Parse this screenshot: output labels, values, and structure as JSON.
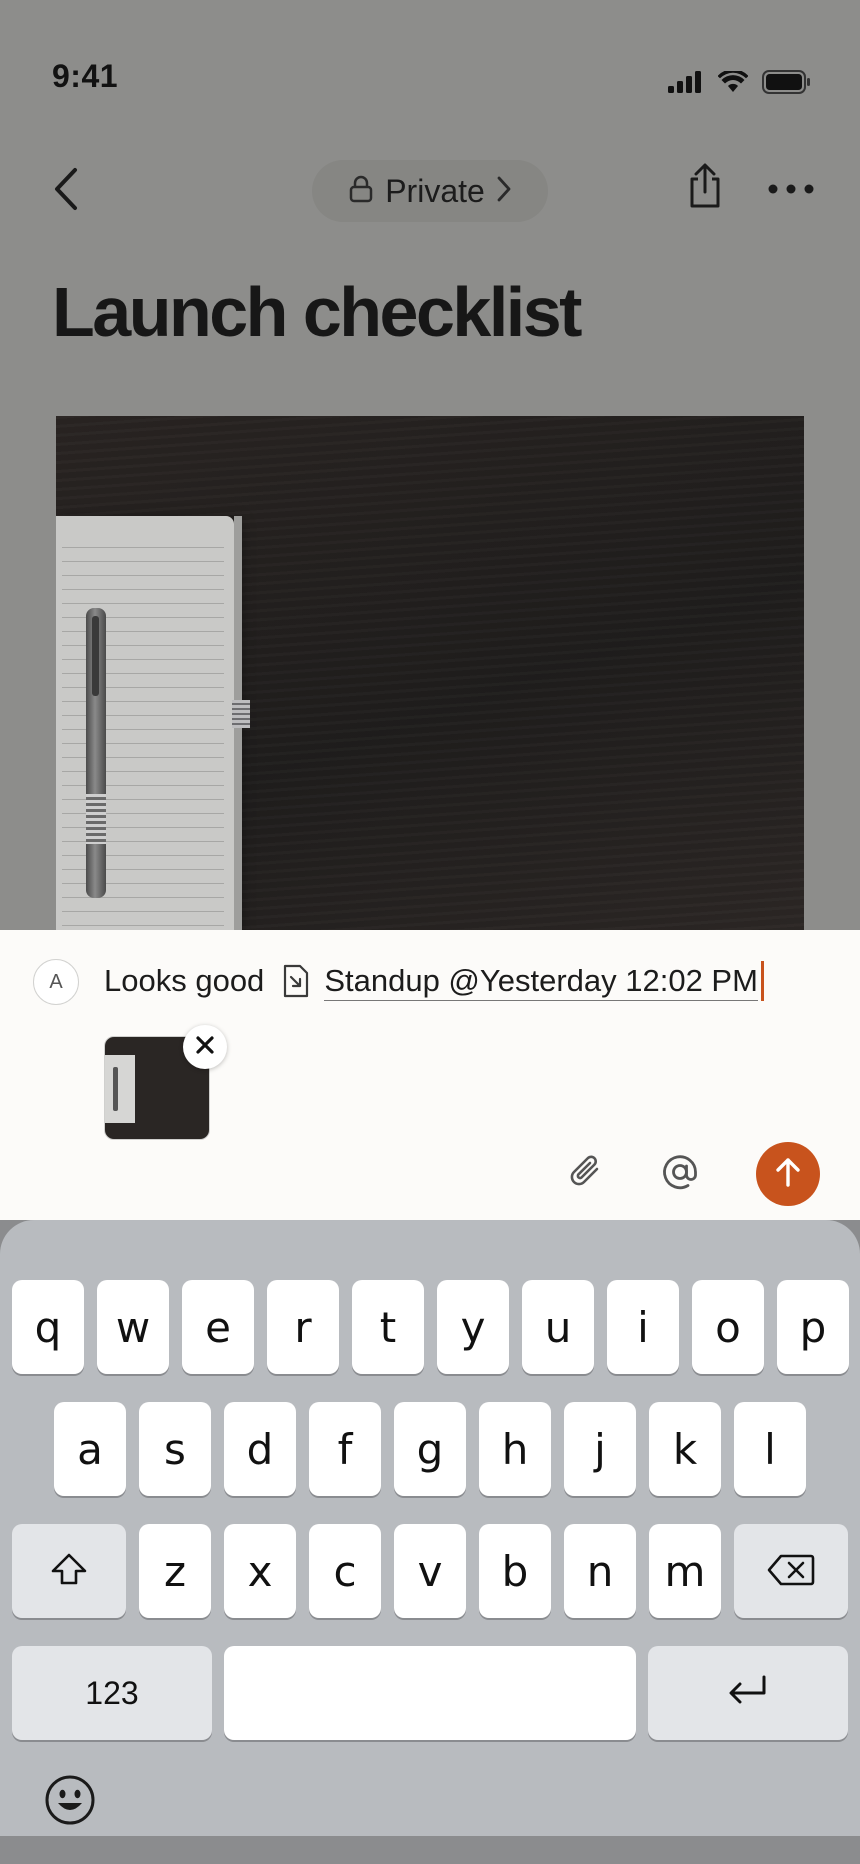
{
  "status_bar": {
    "time": "9:41"
  },
  "nav": {
    "back_icon": "chevron-left-icon",
    "privacy_label": "Private",
    "share_icon": "share-icon",
    "more_icon": "more-horizontal-icon"
  },
  "page": {
    "title": "Launch checklist"
  },
  "composer": {
    "avatar_initial": "A",
    "message_text": "Looks good",
    "mention_text": "Standup @Yesterday 12:02 PM",
    "attachment_icon": "paperclip-icon",
    "mention_icon": "at-sign-icon",
    "send_icon": "arrow-up-icon",
    "accent_color": "#c8531d"
  },
  "keyboard": {
    "rows": [
      [
        "q",
        "w",
        "e",
        "r",
        "t",
        "y",
        "u",
        "i",
        "o",
        "p"
      ],
      [
        "a",
        "s",
        "d",
        "f",
        "g",
        "h",
        "j",
        "k",
        "l"
      ],
      [
        "z",
        "x",
        "c",
        "v",
        "b",
        "n",
        "m"
      ]
    ],
    "numbers_label": "123",
    "shift_icon": "shift-icon",
    "delete_icon": "backspace-icon",
    "return_icon": "return-icon",
    "emoji_icon": "emoji-icon"
  }
}
